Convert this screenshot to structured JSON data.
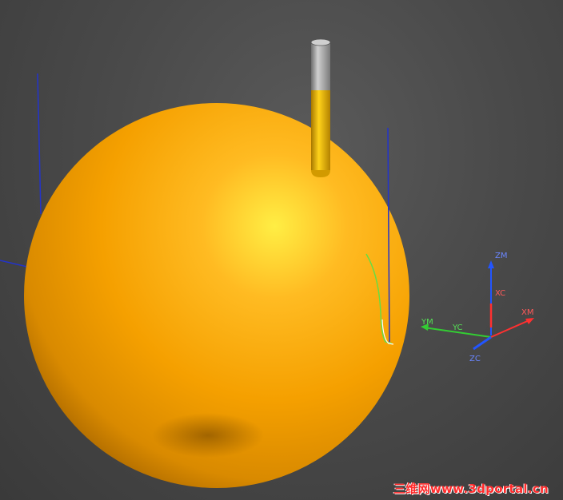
{
  "viewport": {
    "background": "#4a4a4a",
    "model": {
      "shape": "sphere",
      "color": "#f5a000",
      "highlight": "#ffee44"
    },
    "tool": {
      "shank_color": "#9a9a9a",
      "body_color": "#e2a800"
    },
    "toolpath_color": "#66dd44",
    "csys": {
      "zm_label": "ZM",
      "xc_label": "XC",
      "xm_label": "XM",
      "ym_label": "YM",
      "yc_label": "YC",
      "zc_label": "ZC",
      "colors": {
        "x": "#ff3030",
        "y": "#33cc33",
        "z": "#2255ff"
      }
    }
  },
  "watermark": {
    "text": "三维网www.3dportal.cn",
    "color": "#ff2a2a"
  }
}
